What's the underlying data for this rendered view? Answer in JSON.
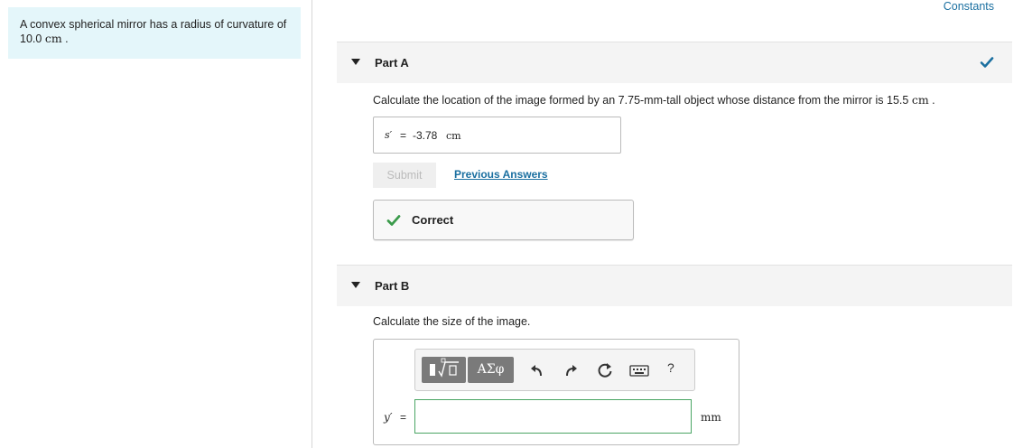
{
  "intro": {
    "text_before": "A convex spherical mirror has a radius of curvature of ",
    "value": "10.0",
    "unit": "cm",
    "text_after": "."
  },
  "header": {
    "constants_label": "Constants"
  },
  "part_a": {
    "title": "Part A",
    "question_text": "Calculate the location of the image formed by an 7.75-mm-tall object whose distance from the mirror is 15.5 ",
    "question_unit": "cm",
    "question_end": ".",
    "answer": {
      "variable": "s′",
      "equals": "=",
      "value": "-3.78",
      "unit": "cm"
    },
    "submit_label": "Submit",
    "previous_answers_label": "Previous Answers",
    "feedback": "Correct",
    "status_color": "#1a6fa0"
  },
  "part_b": {
    "title": "Part B",
    "question_text": "Calculate the size of the image.",
    "toolbar": {
      "greek_label": "ΑΣφ",
      "help_label": "?",
      "icons": [
        "template-icon",
        "undo-icon",
        "redo-icon",
        "reset-icon",
        "keyboard-icon",
        "help-icon"
      ]
    },
    "input": {
      "variable": "y′",
      "equals": "=",
      "value": "",
      "unit": "mm"
    }
  }
}
